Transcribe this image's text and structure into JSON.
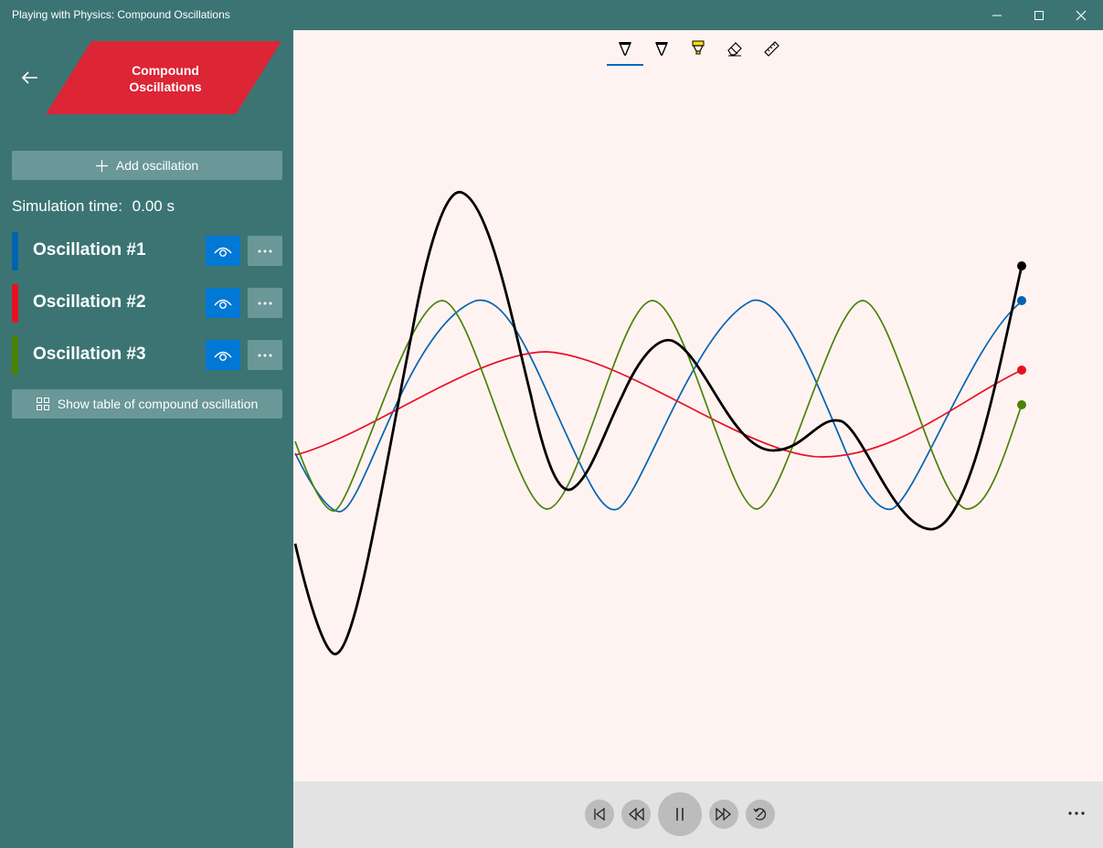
{
  "window": {
    "title": "Playing with Physics: Compound Oscillations",
    "minimize_icon": "minimize-icon",
    "maximize_icon": "maximize-icon",
    "close_icon": "close-icon"
  },
  "sidebar": {
    "back_icon": "arrow-left-icon",
    "logo_lines": [
      "Compound",
      "Oscillations"
    ],
    "logo_color": "#dc2535",
    "add_button_label": "Add oscillation",
    "sim_time_label": "Simulation time:",
    "sim_time_value": "0.00 s",
    "oscillations": [
      {
        "label": "Oscillation #1",
        "color": "#0063b1"
      },
      {
        "label": "Oscillation #2",
        "color": "#e81123"
      },
      {
        "label": "Oscillation #3",
        "color": "#498205"
      }
    ],
    "table_button_label": "Show table of compound oscillation"
  },
  "ink_toolbar": {
    "tools": [
      "ballpoint-pen-icon",
      "pencil-icon",
      "highlighter-icon",
      "eraser-icon",
      "ruler-icon"
    ],
    "selected": "ballpoint-pen-icon"
  },
  "playback": {
    "buttons": [
      "skip-to-start-icon",
      "rewind-icon",
      "pause-icon",
      "fast-forward-icon",
      "reset-icon"
    ],
    "more_icon": "more-horizontal-icon"
  },
  "colors": {
    "sidebar_bg": "#3c7474",
    "canvas_bg": "#fff3f2",
    "accent": "#0078d4",
    "compound": "#000000"
  }
}
